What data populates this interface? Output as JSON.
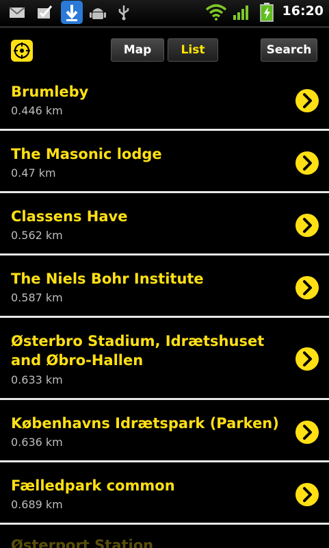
{
  "status_bar": {
    "time": "16:20",
    "icons": [
      "gmail-icon",
      "task-check-icon",
      "download-icon",
      "android-debug-icon",
      "usb-icon",
      "wifi-icon",
      "signal-icon",
      "battery-charging-icon"
    ],
    "colors": {
      "wifi": "#7ec928",
      "download_bg": "#2a7ad6"
    }
  },
  "toolbar": {
    "tabs": [
      {
        "label": "Map"
      },
      {
        "label": "List"
      },
      {
        "label": "Search"
      }
    ],
    "active_tab": "List"
  },
  "places": [
    {
      "name": "Brumleby",
      "distance": "0.446 km"
    },
    {
      "name": "The Masonic lodge",
      "distance": "0.47 km"
    },
    {
      "name": "Classens Have",
      "distance": "0.562 km"
    },
    {
      "name": "The Niels Bohr Institute",
      "distance": "0.587 km"
    },
    {
      "name": "Østerbro Stadium, Idrætshuset and Øbro-Hallen",
      "distance": "0.633 km"
    },
    {
      "name": "Københavns Idrætspark (Parken)",
      "distance": "0.636 km"
    },
    {
      "name": "Fælledpark common",
      "distance": "0.689 km"
    },
    {
      "name": "Østerport Station"
    }
  ],
  "theme": {
    "accent": "#ffe014",
    "background": "#000000",
    "divider": "#e8e8e8"
  }
}
